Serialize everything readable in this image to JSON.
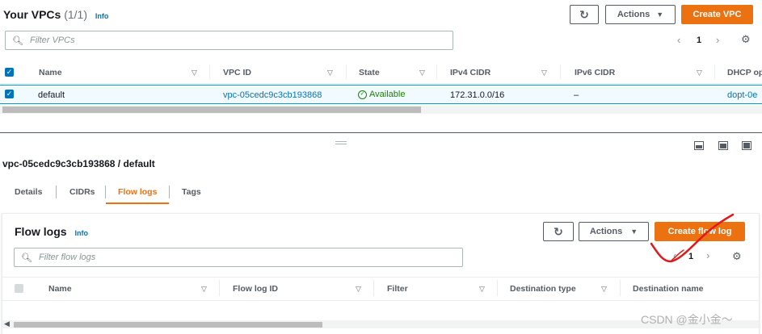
{
  "vpc_panel": {
    "title": "Your VPCs",
    "count": "(1/1)",
    "info": "Info",
    "refresh_icon": "refresh-icon",
    "actions_label": "Actions",
    "create_label": "Create VPC",
    "search_placeholder": "Filter VPCs",
    "page_number": "1",
    "columns": [
      "Name",
      "VPC ID",
      "State",
      "IPv4 CIDR",
      "IPv6 CIDR",
      "DHCP op"
    ],
    "row": {
      "name": "default",
      "vpc_id": "vpc-05cedc9c3cb193868",
      "state": "Available",
      "ipv4": "172.31.0.0/16",
      "ipv6": "–",
      "dhcp": "dopt-0e"
    }
  },
  "details": {
    "heading": "vpc-05cedc9c3cb193868 / default",
    "tabs": [
      "Details",
      "CIDRs",
      "Flow logs",
      "Tags"
    ],
    "active_tab": "Flow logs"
  },
  "flow_logs": {
    "title": "Flow logs",
    "info": "Info",
    "actions_label": "Actions",
    "create_label": "Create flow log",
    "search_placeholder": "Filter flow logs",
    "page_number": "1",
    "columns": [
      "Name",
      "Flow log ID",
      "Filter",
      "Destination type",
      "Destination name"
    ]
  },
  "watermark": "CSDN @金小金～",
  "colors": {
    "accent": "#ec7211",
    "link": "#0073bb",
    "success": "#1d8102",
    "annotation": "#e0191a"
  }
}
